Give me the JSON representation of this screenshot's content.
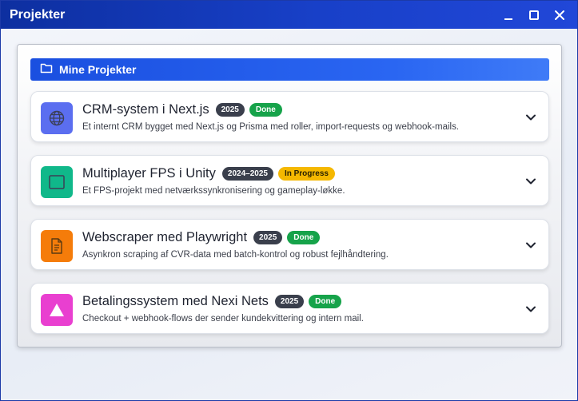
{
  "window": {
    "title": "Projekter",
    "minimize_icon": "minimize-icon",
    "maximize_icon": "maximize-icon",
    "close_icon": "close-icon"
  },
  "panel": {
    "header_title": "Mine Projekter",
    "header_icon": "folder-icon"
  },
  "colors": {
    "titlebar": "#1840c8",
    "header": "#2a66f2",
    "badge_year": "#3a3f4c",
    "status_done": "#16a34a",
    "status_in_progress": "#f5b800"
  },
  "projects": [
    {
      "title": "CRM-system i Next.js",
      "year": "2025",
      "status": "Done",
      "description": "Et internt CRM bygget med Next.js og Prisma med roller, import-requests og webhook-mails.",
      "icon": "globe-icon",
      "icon_color": "#5b6ef0"
    },
    {
      "title": "Multiplayer FPS i Unity",
      "year": "2024–2025",
      "status": "In Progress",
      "description": "Et FPS-projekt med netværkssynkronisering og gameplay-løkke.",
      "icon": "window-icon",
      "icon_color": "#10b88a"
    },
    {
      "title": "Webscraper med Playwright",
      "year": "2025",
      "status": "Done",
      "description": "Asynkron scraping af CVR-data med batch-kontrol og robust fejlhåndtering.",
      "icon": "document-icon",
      "icon_color": "#f57c0a"
    },
    {
      "title": "Betalingssystem med Nexi Nets",
      "year": "2025",
      "status": "Done",
      "description": "Checkout + webhook-flows der sender kundekvittering og intern mail.",
      "icon": "triangle-icon",
      "icon_color": "#e93fd0"
    }
  ]
}
